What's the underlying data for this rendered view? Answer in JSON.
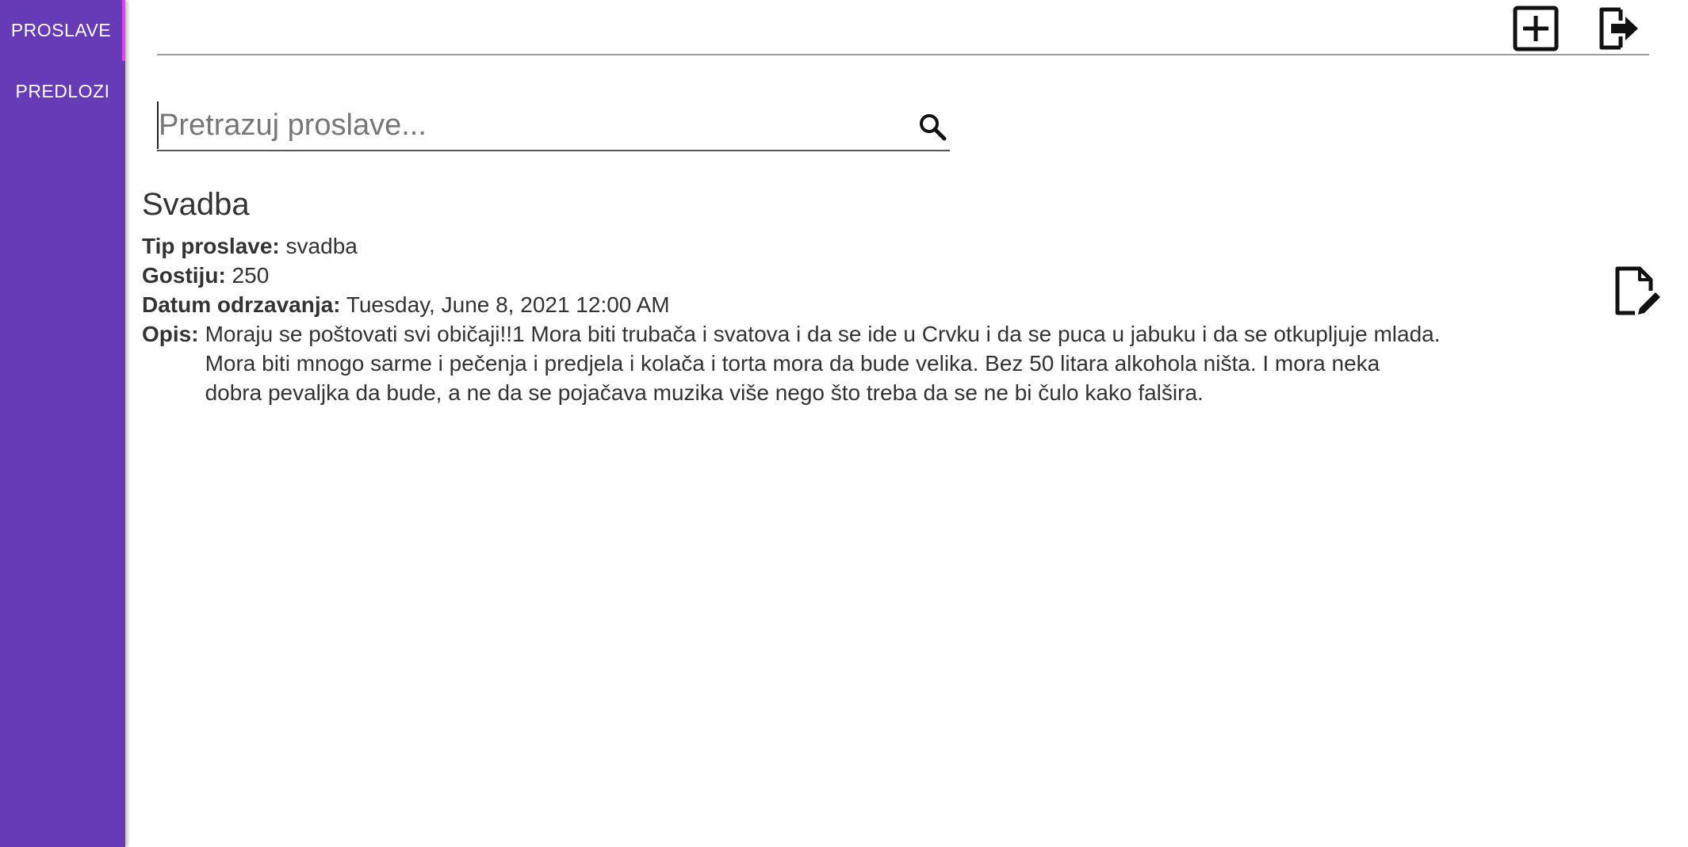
{
  "sidebar": {
    "items": [
      {
        "label": "PROSLAVE",
        "active": true
      },
      {
        "label": "PREDLOZI",
        "active": false
      }
    ],
    "color": "#673ab7",
    "active_indicator_color": "#e040fb"
  },
  "toolbar": {
    "add_icon": "add-box-icon",
    "logout_icon": "logout-icon"
  },
  "search": {
    "placeholder": "Pretrazuj proslave...",
    "value": "",
    "icon": "search-icon"
  },
  "celebration": {
    "title": "Svadba",
    "type_label": "Tip proslave:",
    "type_value": "svadba",
    "guests_label": "Gostiju:",
    "guests_value": "250",
    "date_label": "Datum odrzavanja:",
    "date_value": "Tuesday, June 8, 2021 12:00 AM",
    "description_label": "Opis:",
    "description_value": "Moraju se poštovati svi običaji!!1 Mora biti trubača i svatova i da se ide u Crvku i da se puca u jabuku i da se otkupljuje mlada. Mora biti mnogo sarme i pečenja i predjela i kolača i torta mora da bude velika. Bez 50 litara alkohola ništa. I mora neka dobra pevaljka da bude, a ne da se pojačava muzika više nego što treba da se ne bi čulo kako falšira.",
    "edit_icon": "edit-document-icon"
  }
}
